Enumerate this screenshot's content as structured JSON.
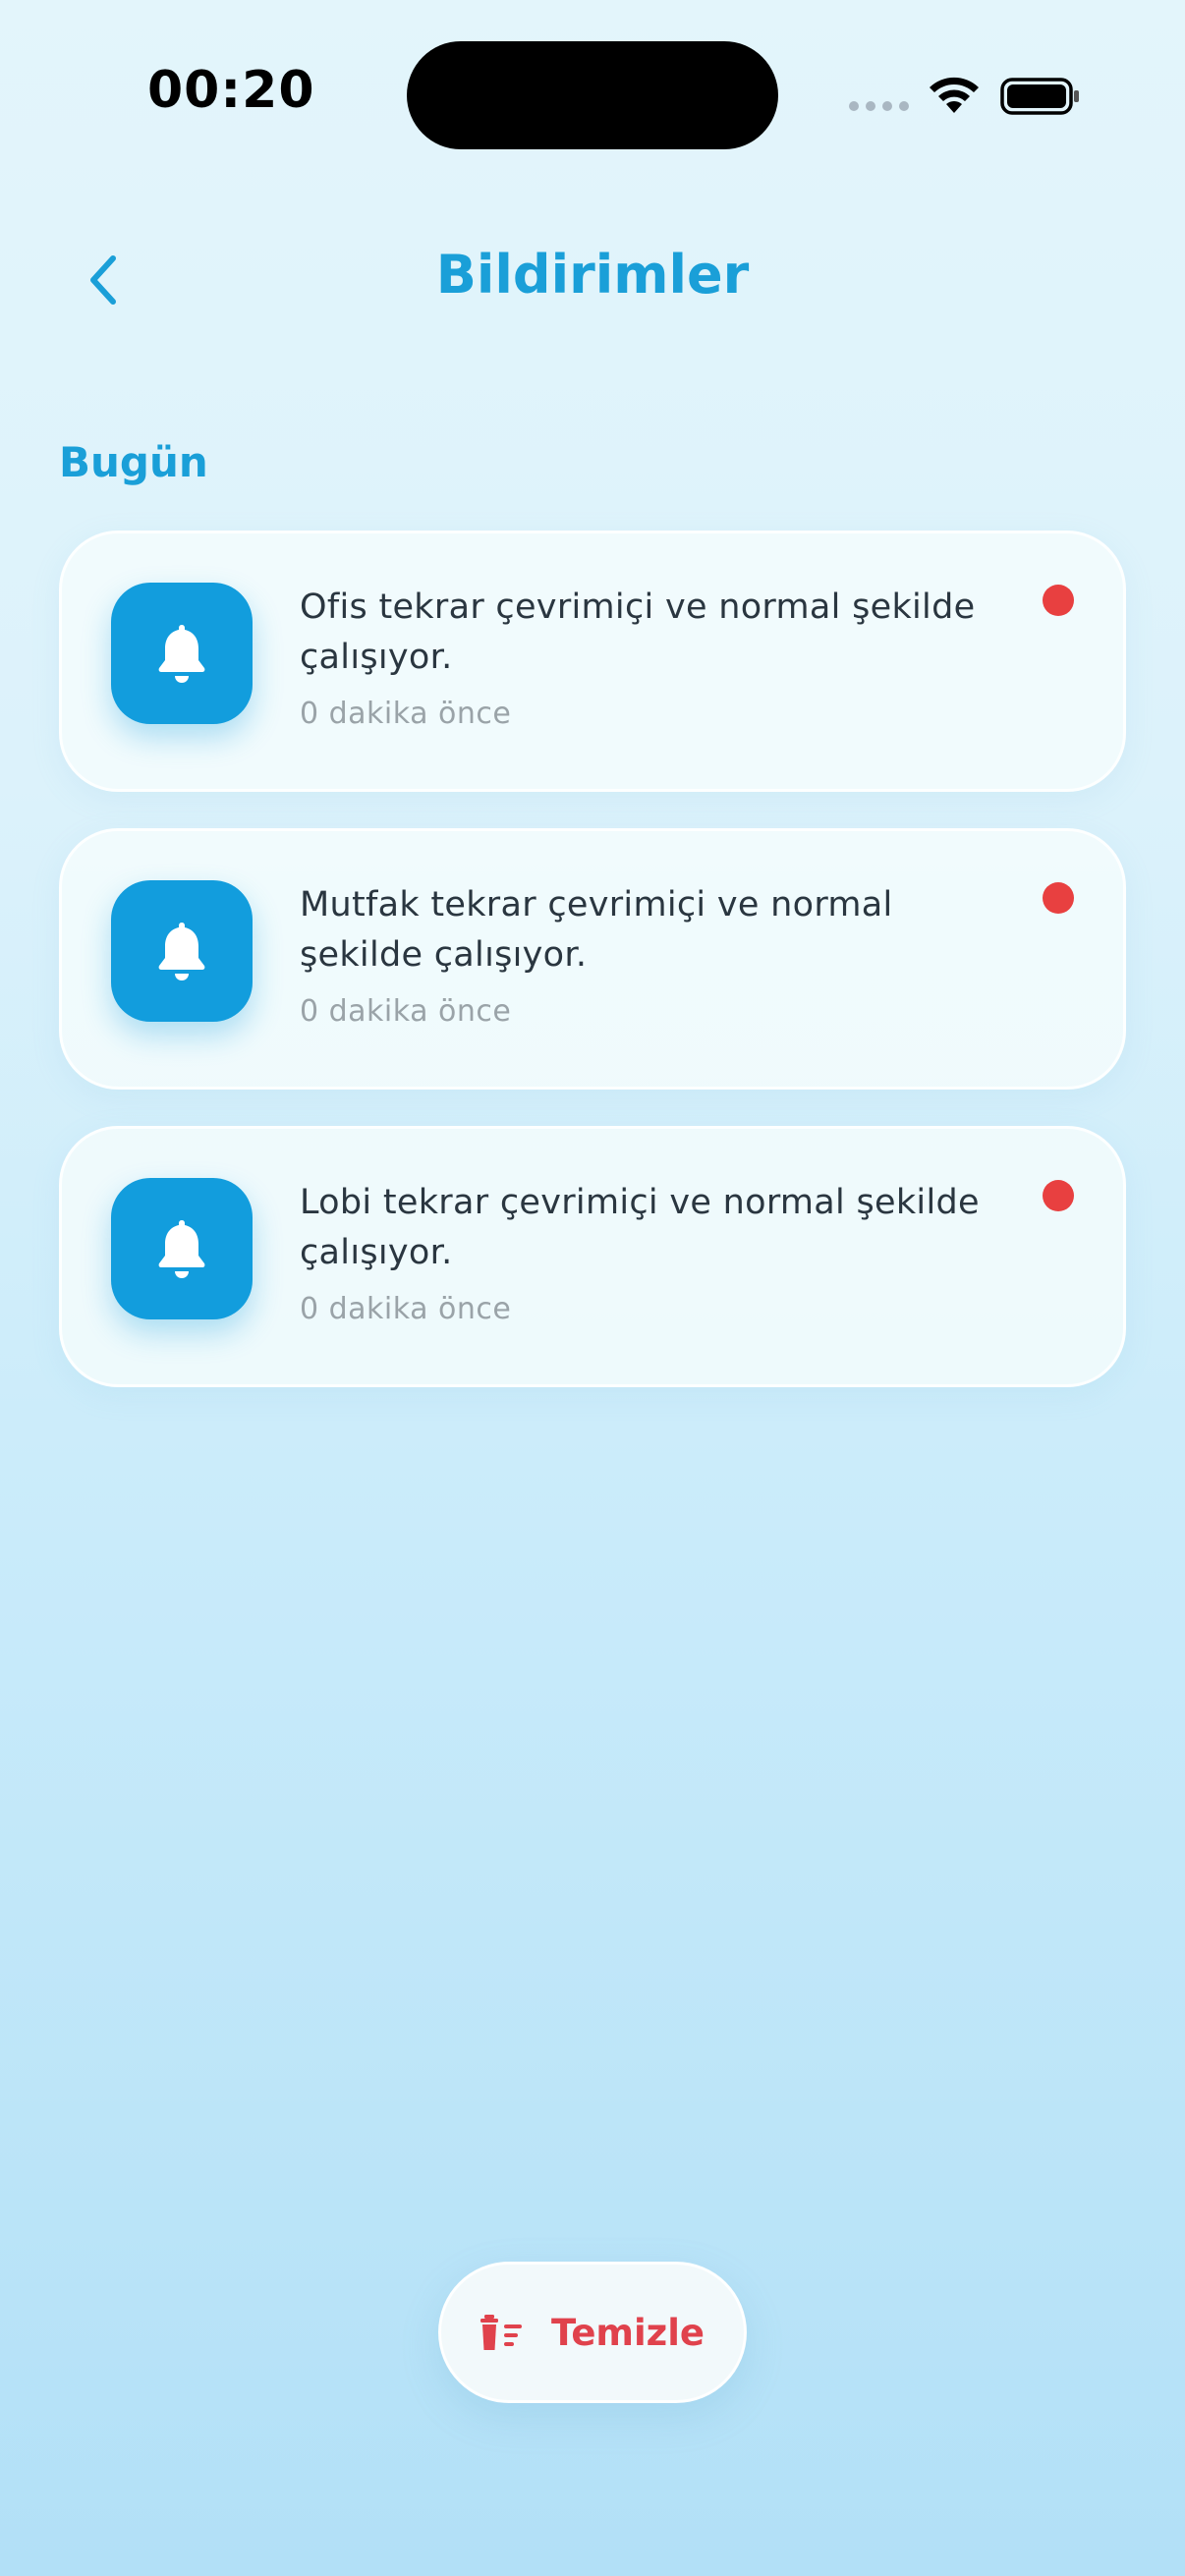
{
  "status_bar": {
    "time": "00:20"
  },
  "header": {
    "title": "Bildirimler",
    "back_icon": "chevron-left-icon"
  },
  "section": {
    "title": "Bugün"
  },
  "notifications": [
    {
      "message": "Ofis tekrar çevrimiçi ve normal şekilde çalışıyor.",
      "time": "0 dakika önce",
      "icon": "bell-icon",
      "unread": true
    },
    {
      "message": "Mutfak tekrar çevrimiçi ve normal şekilde çalışıyor.",
      "time": "0 dakika önce",
      "icon": "bell-icon",
      "unread": true
    },
    {
      "message": "Lobi tekrar çevrimiçi ve normal şekilde çalışıyor.",
      "time": "0 dakika önce",
      "icon": "bell-icon",
      "unread": true
    }
  ],
  "clear_button": {
    "label": "Temizle",
    "icon": "trash-icon"
  },
  "colors": {
    "accent": "#1a9fd8",
    "icon_bg": "#129ddd",
    "unread": "#e84040",
    "danger": "#e0424c"
  }
}
